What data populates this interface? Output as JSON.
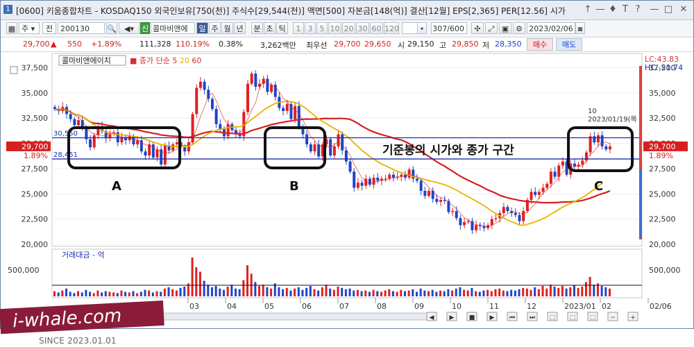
{
  "titlebar": {
    "window_no": "1",
    "title": "[0600] 키움종합차트 - KOSDAQ150 외국인보유[750(천)] 주식수[29,544(천)] 액면[500] 자본금[148(억)] 결산[12월] EPS[2,365] PER[12.56] 시가",
    "controls": [
      "↑",
      "—",
      "♦",
      "T",
      "?",
      "—",
      "□",
      "✕"
    ]
  },
  "toolbar": {
    "period_select": "주",
    "alt_select": "전",
    "code": "200130",
    "tag": "신",
    "name": "콜마비앤에",
    "period_buttons": [
      "일",
      "주",
      "월",
      "년",
      "분",
      "초",
      "틱"
    ],
    "interval_buttons": [
      "1",
      "3",
      "5",
      "10",
      "20",
      "30",
      "60",
      "120"
    ],
    "count": "307/600",
    "date": "2023/02/06"
  },
  "quote": {
    "price": "29,700",
    "direction": "▲",
    "change": "550",
    "change_pct": "+1.89%",
    "volume": "111,328",
    "volume_ratio": "110.19%",
    "turnover": "0.38%",
    "amount": "3,262백만",
    "best_label": "최우선",
    "best_ask": "29,700",
    "best_bid": "29,650",
    "open_label": "시",
    "open": "29,150",
    "high_label": "고",
    "high": "29,850",
    "low_label": "저",
    "low": "28,350",
    "buy_label": "매수",
    "sell_label": "매도"
  },
  "chart_data": {
    "type": "candlestick",
    "stock_name": "콜마비앤에이치",
    "ma_legend": {
      "label": "종가 단순",
      "periods": [
        "5",
        "20",
        "60"
      ],
      "colors": [
        "#d62f2f",
        "#e6b400",
        "#d62f2f"
      ]
    },
    "y_ticks": [
      "37,500",
      "35,000",
      "32,500",
      "30,000",
      "27,500",
      "25,000",
      "22,500",
      "20,000"
    ],
    "y_range": [
      19800,
      38900
    ],
    "x_ticks": [
      "03",
      "04",
      "05",
      "06",
      "07",
      "08",
      "09",
      "10",
      "11",
      "12",
      "2023/01",
      "02",
      "02/06"
    ],
    "right_labels": {
      "lc": "LC:43.83",
      "hc": "HC:-21.74",
      "price": "29,700",
      "pct": "1.89%"
    },
    "left_labels": {
      "upper": "30,550",
      "lower": "28,451",
      "price": "29,700",
      "pct": "1.89%"
    },
    "annotation": "기준봉의 시가와 종가 구간",
    "box_labels": [
      "A",
      "B",
      "C"
    ],
    "peak_note": {
      "value": "10",
      "date": "2023/01/19(목"
    },
    "hlines": [
      30550,
      28451
    ],
    "volume_panel": {
      "title": "거래대금 - 억",
      "tick": "500,000"
    },
    "close_series": [
      33400,
      33200,
      33600,
      32900,
      32400,
      31800,
      32300,
      31500,
      30400,
      29600,
      30800,
      31700,
      31200,
      30500,
      30900,
      31100,
      30100,
      30600,
      30300,
      30700,
      29900,
      30300,
      29200,
      28800,
      29900,
      28600,
      29400,
      27900,
      29800,
      29300,
      29900,
      30100,
      29600,
      29200,
      30100,
      32900,
      35500,
      36100,
      35300,
      34400,
      33400,
      31900,
      31400,
      30700,
      31900,
      31300,
      30900,
      30700,
      33100,
      35900,
      36900,
      35600,
      35900,
      36400,
      35100,
      35800,
      34600,
      33500,
      33200,
      33900,
      32400,
      33700,
      31600,
      30900,
      29900,
      29200,
      29900,
      28700,
      29900,
      30400,
      28800,
      29700,
      30900,
      29300,
      28200,
      27200,
      25600,
      26100,
      25800,
      26500,
      25900,
      26600,
      26300,
      26500,
      26500,
      26900,
      26600,
      26700,
      26900,
      26600,
      27400,
      26500,
      26300,
      25300,
      24800,
      25300,
      24500,
      24200,
      24400,
      24300,
      23200,
      23300,
      22600,
      21900,
      22200,
      22300,
      21400,
      21900,
      21800,
      21600,
      21900,
      22500,
      22600,
      23100,
      23700,
      23300,
      23100,
      22900,
      22300,
      23300,
      24400,
      25200,
      24900,
      25200,
      25600,
      26000,
      27200,
      26700,
      27800,
      28200,
      26900,
      28000,
      27700,
      27900,
      28300,
      29100,
      30700,
      30100,
      30800,
      29700,
      29400,
      29700
    ],
    "ma5_series": [
      33400,
      33300,
      33400,
      33280,
      33100,
      32780,
      32600,
      32180,
      31680,
      31120,
      30920,
      30860,
      30740,
      30760,
      31020,
      31040,
      30760,
      30640,
      30580,
      30640,
      30320,
      30360,
      30080,
      29860,
      29820,
      29560,
      29380,
      29120,
      29120,
      29000,
      29260,
      29400,
      29740,
      29820,
      29800,
      30380,
      31460,
      32640,
      33580,
      34740,
      34940,
      34220,
      33280,
      32360,
      31880,
      31440,
      31240,
      30980,
      31580,
      32380,
      33300,
      34040,
      35480,
      36140,
      35980,
      35760,
      35560,
      35120,
      34440,
      34200,
      33520,
      33340,
      32960,
      32320,
      31500,
      30660,
      30300,
      29740,
      29720,
      29820,
      29540,
      29900,
      30140,
      29820,
      29380,
      28840,
      27920,
      27280,
      26580,
      26240,
      26000,
      26180,
      26220,
      26360,
      26360,
      26540,
      26540,
      26640,
      26720,
      26740,
      26900,
      26820,
      26700,
      26420,
      26060,
      25640,
      25240,
      24820,
      24640,
      24540,
      24120,
      23880,
      23540,
      23060,
      22640,
      22460,
      22080,
      21940,
      21920,
      21840,
      21720,
      21940,
      22080,
      22340,
      22760,
      23040,
      23160,
      23220,
      23060,
      22980,
      23200,
      23620,
      24020,
      24600,
      25060,
      25380,
      25780,
      26140,
      26660,
      27180,
      27360,
      27520,
      27720,
      27740,
      27760,
      28240,
      28920,
      29220,
      29800,
      30080,
      30140,
      29940
    ],
    "ma20_series": [
      33400,
      33300,
      33400,
      33275,
      33100,
      32883,
      32800,
      32638,
      32389,
      32110,
      31800,
      31575,
      31300,
      31085,
      31000,
      30970,
      30870,
      30830,
      30780,
      30770,
      30693,
      30639,
      30507,
      30385,
      30270,
      30128,
      30000,
      29865,
      29828,
      29758,
      29705,
      29703,
      29703,
      29683,
      29720,
      29885,
      30163,
      30456,
      30723,
      30951,
      31130,
      31286,
      31388,
      31464,
      31558,
      31620,
      31648,
      31648,
      31804,
      32065,
      32384,
      32670,
      32968,
      33282,
      33530,
      33761,
      33953,
      34057,
      34117,
      34162,
      34110,
      34053,
      33886,
      33661,
      33385,
      33037,
      32730,
      32417,
      32167,
      31943,
      31683,
      31462,
      31271,
      31018,
      30748,
      30432,
      30031,
      29663,
      29305,
      29005,
      28695,
      28440,
      28189,
      27955,
      27775,
      27595,
      27411,
      27226,
      27101,
      26965,
      26835,
      26725,
      26625,
      26511,
      26400,
      26323,
      26221,
      26124,
      26019,
      25901,
      25735,
      25560,
      25370,
      25133,
      24921,
      24728,
      24500,
      24283,
      24062,
      23842,
      23567,
      23290,
      23046,
      22826,
      22616,
      22396,
      22232,
      22087,
      21920,
      21880,
      21976,
      22109,
      22233,
      22379,
      22549,
      22743,
      22993,
      23215,
      23465,
      23693,
      23882,
      24055,
      24240,
      24427,
      24651,
      24870,
      25168,
      25451,
      25773,
      26027
    ],
    "ma60_series": [
      33400,
      33300,
      33400,
      33275,
      33100,
      32883,
      32800,
      32638,
      32389,
      32110,
      31800,
      31575,
      31300,
      31085,
      31000,
      30970,
      30870,
      30830,
      30780,
      30770,
      30693,
      30639,
      30507,
      30385,
      30270,
      30128,
      30000,
      29865,
      29828,
      29758,
      29705,
      29703,
      29703,
      29683,
      29720,
      29885,
      30163,
      30456,
      30723,
      30951,
      31130,
      31286,
      31388,
      31464,
      31558,
      31620,
      31648,
      31648,
      31804,
      32065,
      32384,
      32670,
      32968,
      33282,
      33530,
      33761,
      33953,
      34057,
      34117,
      34162,
      34110,
      34053,
      33886,
      33661,
      33385,
      33037,
      32730,
      32417,
      32167,
      31943,
      31683,
      31462,
      31271,
      31018,
      30748,
      30432,
      30031,
      29663,
      29305,
      29005,
      28695,
      28440,
      28189,
      27955,
      27775,
      27595,
      27411,
      27226,
      27101,
      26965,
      26835,
      26725,
      26625,
      26511,
      26400,
      26323,
      26221,
      26124,
      26019,
      25901,
      25735,
      25560,
      25370,
      25133,
      24921,
      24728,
      24500,
      24283,
      24062,
      23842,
      23567,
      23290,
      23046,
      22826,
      22616,
      22396,
      22232,
      22087,
      21920,
      21880,
      21976,
      22109,
      22233,
      22379,
      22549,
      22743,
      22993,
      23215,
      23465,
      23693,
      23882,
      24055,
      24240,
      24427,
      24651,
      24870,
      25168,
      25451,
      25773,
      26027
    ],
    "volume_series": [
      8,
      6,
      9,
      12,
      7,
      5,
      8,
      6,
      10,
      7,
      5,
      9,
      6,
      8,
      7,
      6,
      5,
      9,
      7,
      6,
      8,
      5,
      7,
      10,
      9,
      6,
      8,
      7,
      12,
      14,
      11,
      9,
      13,
      15,
      20,
      60,
      45,
      38,
      24,
      18,
      14,
      16,
      12,
      10,
      15,
      18,
      12,
      11,
      25,
      48,
      35,
      22,
      16,
      18,
      14,
      12,
      20,
      14,
      11,
      13,
      9,
      12,
      14,
      10,
      13,
      16,
      11,
      9,
      14,
      18,
      12,
      10,
      15,
      13,
      11,
      12,
      9,
      10,
      8,
      9,
      7,
      10,
      8,
      7,
      9,
      11,
      8,
      7,
      10,
      8,
      9,
      11,
      7,
      12,
      9,
      8,
      10,
      7,
      9,
      8,
      11,
      9,
      12,
      14,
      10,
      9,
      13,
      8,
      7,
      9,
      10,
      8,
      11,
      12,
      9,
      8,
      10,
      9,
      11,
      13,
      12,
      10,
      14,
      11,
      16,
      12,
      18,
      15,
      13,
      16,
      12,
      14,
      17,
      13,
      15,
      22,
      30,
      18,
      20,
      16,
      14,
      12
    ]
  },
  "scrollbar": {
    "buttons": [
      "◀",
      "▶",
      "■",
      "▶",
      "⏮",
      "⏭",
      "⬚",
      "⬚",
      "⬚",
      "−",
      "+"
    ]
  },
  "watermark": {
    "logo": "i-whale.com",
    "since": "SINCE 2023.01.01"
  }
}
